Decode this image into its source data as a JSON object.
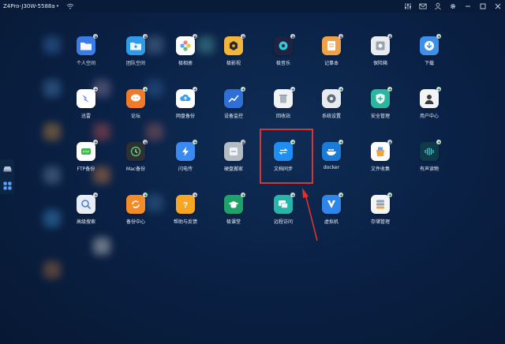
{
  "topbar": {
    "device": "Z4Pro-J30W-5588a"
  },
  "colors": {
    "highlight": "#e0322f",
    "background": "#0a2146"
  },
  "apps": [
    {
      "label": "个人空间",
      "icon": "folder-icon",
      "color": "#3a7be6"
    },
    {
      "label": "团队空间",
      "icon": "team-folder-icon",
      "color": "#2e9be8"
    },
    {
      "label": "极相册",
      "icon": "photos-icon",
      "color": "#ffffff"
    },
    {
      "label": "极影视",
      "icon": "film-icon",
      "color": "#f2b43a"
    },
    {
      "label": "极音乐",
      "icon": "music-icon",
      "color": "#1d2340"
    },
    {
      "label": "记事本",
      "icon": "notepad-icon",
      "color": "#f0a24a"
    },
    {
      "label": "保险箱",
      "icon": "safe-icon",
      "color": "#e8ecf0"
    },
    {
      "label": "下载",
      "icon": "download-icon",
      "color": "#3d8fe8"
    },
    {
      "label": "迅雷",
      "icon": "thunder-icon",
      "color": "#ffffff"
    },
    {
      "label": "论坛",
      "icon": "forum-icon",
      "color": "#f07a2a"
    },
    {
      "label": "网盘备份",
      "icon": "cloud-backup-icon",
      "color": "#ffffff"
    },
    {
      "label": "设备监控",
      "icon": "monitor-chart-icon",
      "color": "#2f6fd6"
    },
    {
      "label": "回收站",
      "icon": "trash-icon",
      "color": "#f0f2f4"
    },
    {
      "label": "系统设置",
      "icon": "settings-icon",
      "color": "#e8ebee"
    },
    {
      "label": "安全管理",
      "icon": "shield-icon",
      "color": "#2cb6a0"
    },
    {
      "label": "用户中心",
      "icon": "user-icon",
      "color": "#f3f4f6"
    },
    {
      "label": "FTP备份",
      "icon": "ftp-icon",
      "color": "#ffffff"
    },
    {
      "label": "Mac备份",
      "icon": "time-machine-icon",
      "color": "#2e2f33"
    },
    {
      "label": "闪电传",
      "icon": "flash-transfer-icon",
      "color": "#3b8af0"
    },
    {
      "label": "硬盘搬家",
      "icon": "disk-move-icon",
      "color": "#b4bcc4"
    },
    {
      "label": "文档同步",
      "icon": "sync-icon",
      "color": "#1e8ef2"
    },
    {
      "label": "docker",
      "icon": "docker-icon",
      "color": "#1b7cd8"
    },
    {
      "label": "文件收集",
      "icon": "file-collect-icon",
      "color": "#ffffff"
    },
    {
      "label": "有声读物",
      "icon": "audiobook-icon",
      "color": "#0f3a4a"
    },
    {
      "label": "高级搜索",
      "icon": "search-icon",
      "color": "#e8edf3"
    },
    {
      "label": "备份中心",
      "icon": "backup-center-icon",
      "color": "#f28c28"
    },
    {
      "label": "帮助与反馈",
      "icon": "help-icon",
      "color": "#f6a623"
    },
    {
      "label": "极课堂",
      "icon": "classroom-icon",
      "color": "#1fa16a"
    },
    {
      "label": "远程访问",
      "icon": "remote-access-icon",
      "color": "#26b5a8"
    },
    {
      "label": "虚拟机",
      "icon": "vm-icon",
      "color": "#2f86e8"
    },
    {
      "label": "存储管理",
      "icon": "storage-icon",
      "color": "#f3f4f6"
    }
  ]
}
